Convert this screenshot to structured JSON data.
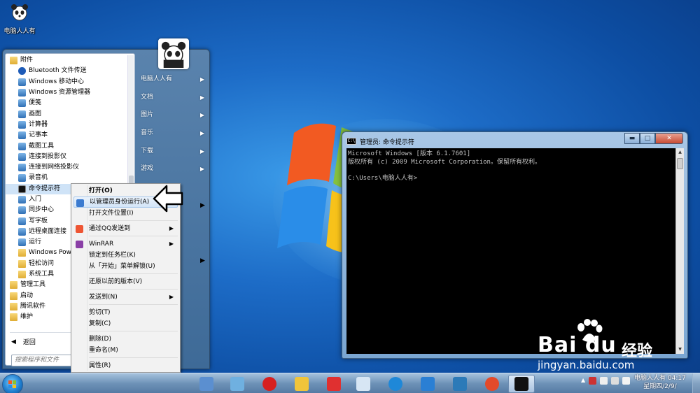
{
  "desktop": {
    "icon_label": "电脑人人有"
  },
  "start_menu": {
    "programs": [
      {
        "label": "附件",
        "icon": "folder-icon",
        "level": 0
      },
      {
        "label": "Bluetooth 文件传送",
        "icon": "bluetooth-icon",
        "level": 1
      },
      {
        "label": "Windows 移动中心",
        "icon": "mobility-icon",
        "level": 1
      },
      {
        "label": "Windows 资源管理器",
        "icon": "explorer-icon",
        "level": 1
      },
      {
        "label": "便笺",
        "icon": "sticky-notes-icon",
        "level": 1
      },
      {
        "label": "画图",
        "icon": "paint-icon",
        "level": 1
      },
      {
        "label": "计算器",
        "icon": "calculator-icon",
        "level": 1
      },
      {
        "label": "记事本",
        "icon": "notepad-icon",
        "level": 1
      },
      {
        "label": "截图工具",
        "icon": "snipping-icon",
        "level": 1
      },
      {
        "label": "连接到投影仪",
        "icon": "projector-icon",
        "level": 1
      },
      {
        "label": "连接到网络投影仪",
        "icon": "network-projector-icon",
        "level": 1
      },
      {
        "label": "录音机",
        "icon": "recorder-icon",
        "level": 1
      },
      {
        "label": "命令提示符",
        "icon": "cmd-icon",
        "level": 1
      },
      {
        "label": "入门",
        "icon": "getting-started-icon",
        "level": 1
      },
      {
        "label": "同步中心",
        "icon": "sync-icon",
        "level": 1
      },
      {
        "label": "写字板",
        "icon": "wordpad-icon",
        "level": 1
      },
      {
        "label": "远程桌面连接",
        "icon": "remote-desktop-icon",
        "level": 1
      },
      {
        "label": "运行",
        "icon": "run-icon",
        "level": 1
      },
      {
        "label": "Windows Powe",
        "icon": "folder-icon",
        "level": 1
      },
      {
        "label": "轻松访问",
        "icon": "folder-icon",
        "level": 1
      },
      {
        "label": "系统工具",
        "icon": "folder-icon",
        "level": 1
      },
      {
        "label": "管理工具",
        "icon": "folder-icon",
        "level": 0
      },
      {
        "label": "启动",
        "icon": "folder-icon",
        "level": 0
      },
      {
        "label": "腾讯软件",
        "icon": "folder-icon",
        "level": 0
      },
      {
        "label": "维护",
        "icon": "folder-icon",
        "level": 0
      }
    ],
    "highlighted_index": 12,
    "back_label": "返回",
    "search_placeholder": "搜索程序和文件",
    "right_items": [
      "电脑人人有",
      "文档",
      "图片",
      "音乐",
      "下载",
      "游戏"
    ]
  },
  "context_menu": {
    "items": [
      {
        "label": "打开(O)",
        "bold": true,
        "submenu": false,
        "icon": ""
      },
      {
        "label": "以管理员身份运行(A)",
        "bold": false,
        "submenu": false,
        "icon": "uac-shield-icon",
        "highlight": true
      },
      {
        "label": "打开文件位置(I)",
        "bold": false,
        "submenu": false,
        "icon": ""
      },
      {
        "label": "通过QQ发送到",
        "bold": false,
        "submenu": true,
        "icon": "qq-icon"
      },
      {
        "label": "WinRAR",
        "bold": false,
        "submenu": true,
        "icon": "winrar-icon"
      },
      {
        "label": "锁定到任务栏(K)",
        "bold": false,
        "submenu": false,
        "icon": ""
      },
      {
        "label": "从「开始」菜单解锁(U)",
        "bold": false,
        "submenu": false,
        "icon": ""
      },
      {
        "label": "还原以前的版本(V)",
        "bold": false,
        "submenu": false,
        "icon": ""
      },
      {
        "label": "发送到(N)",
        "bold": false,
        "submenu": true,
        "icon": ""
      },
      {
        "label": "剪切(T)",
        "bold": false,
        "submenu": false,
        "icon": ""
      },
      {
        "label": "复制(C)",
        "bold": false,
        "submenu": false,
        "icon": ""
      },
      {
        "label": "删除(D)",
        "bold": false,
        "submenu": false,
        "icon": ""
      },
      {
        "label": "重命名(M)",
        "bold": false,
        "submenu": false,
        "icon": ""
      },
      {
        "label": "属性(R)",
        "bold": false,
        "submenu": false,
        "icon": ""
      }
    ]
  },
  "cmd_window": {
    "title": "管理员: 命令提示符",
    "lines": [
      "Microsoft Windows [版本 6.1.7601]",
      "版权所有 (c) 2009 Microsoft Corporation。保留所有权利。",
      "",
      "C:\\Users\\电脑人人有>"
    ]
  },
  "watermark": {
    "brand": "Bai du",
    "product": "经验",
    "url": "jingyan.baidu.com"
  },
  "taskbar": {
    "pinned": [
      "show-desktop-icon",
      "computer-manager-icon",
      "chinese-chess-icon",
      "folder-icon",
      "wps-icon",
      "paint-brush-icon",
      "sogou-icon",
      "ie-icon",
      "gear-app-icon",
      "chrome-icon",
      "cmd-icon"
    ],
    "clock_title": "电脑人人有 04:17",
    "clock_date": "星期四/2/9/"
  },
  "colors": {
    "desktop": "#1d6cc7",
    "highlight": "#cfe3f7",
    "cmd_bg": "#000000",
    "cmd_text": "#c0c0c0"
  }
}
